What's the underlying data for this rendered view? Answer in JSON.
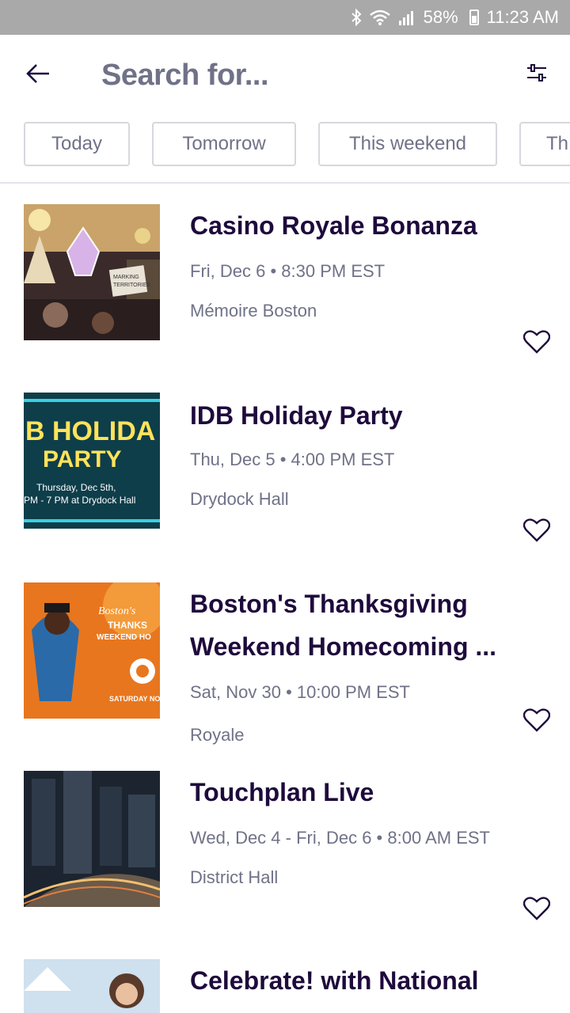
{
  "statusbar": {
    "bluetooth_icon": "bluetooth-icon",
    "wifi_icon": "wifi-icon",
    "signal_icon": "signal-icon",
    "battery_percent": "58%",
    "time": "11:23 AM"
  },
  "header": {
    "back_icon": "back-arrow-icon",
    "search_text": "Search for...",
    "filter_icon": "filter-icon"
  },
  "chips": [
    {
      "label": "Today"
    },
    {
      "label": "Tomorrow"
    },
    {
      "label": "This weekend"
    },
    {
      "label": "Th"
    }
  ],
  "events": [
    {
      "title": "Casino Royale Bonanza",
      "date": "Fri, Dec 6 • 8:30 PM EST",
      "venue": "Mémoire Boston"
    },
    {
      "title": "IDB Holiday Party",
      "date": "Thu, Dec 5 • 4:00 PM EST",
      "venue": "Drydock Hall"
    },
    {
      "title": "Boston's Thanksgiving Weekend Homecoming ...",
      "date": "Sat, Nov 30 • 10:00 PM EST",
      "venue": "Royale"
    },
    {
      "title": "Touchplan Live",
      "date": "Wed, Dec 4 - Fri, Dec 6 • 8:00 AM EST",
      "venue": "District Hall"
    },
    {
      "title": "Celebrate! with National",
      "date": "",
      "venue": ""
    }
  ],
  "thumbs": {
    "casino_tag": "MARKING TERRITORIES",
    "holiday_line1": "B HOLIDA",
    "holiday_line2": "PARTY",
    "holiday_line3": "Thursday, Dec 5th,",
    "holiday_line4": "PM - 7 PM at Drydock Hall",
    "thanks_line1": "Boston's",
    "thanks_line2": "THANKS",
    "thanks_line3": "WEEKEND HO",
    "thanks_line4": "SATURDAY NO"
  },
  "colors": {
    "title": "#1e0a3c",
    "muted": "#6f7287",
    "statusbar": "#a9a9a9",
    "chip_border": "#d7d7dd"
  }
}
